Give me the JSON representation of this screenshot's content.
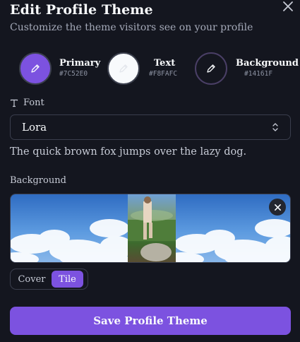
{
  "header": {
    "title": "Edit Profile Theme",
    "subtitle": "Customize the theme visitors see on your profile",
    "close_icon": "close-icon"
  },
  "colors": [
    {
      "name": "Primary",
      "hex": "#7C52E0",
      "value": "#7c52e0",
      "icon": "pencil-icon"
    },
    {
      "name": "Text",
      "hex": "#F8FAFC",
      "value": "#f8fafc",
      "icon": "pencil-icon"
    },
    {
      "name": "Background",
      "hex": "#14161F",
      "value": "#14161f",
      "icon": "pencil-icon"
    }
  ],
  "font": {
    "label": "Font",
    "label_icon": "text-icon",
    "selected": "Lora",
    "select_icon": "chevron-up-down-icon",
    "preview": "The quick brown fox jumps over the lazy dog."
  },
  "background": {
    "label": "Background",
    "remove_icon": "close-icon",
    "modes": [
      "Cover",
      "Tile"
    ],
    "selected_mode": "Tile"
  },
  "save_label": "Save Profile Theme"
}
